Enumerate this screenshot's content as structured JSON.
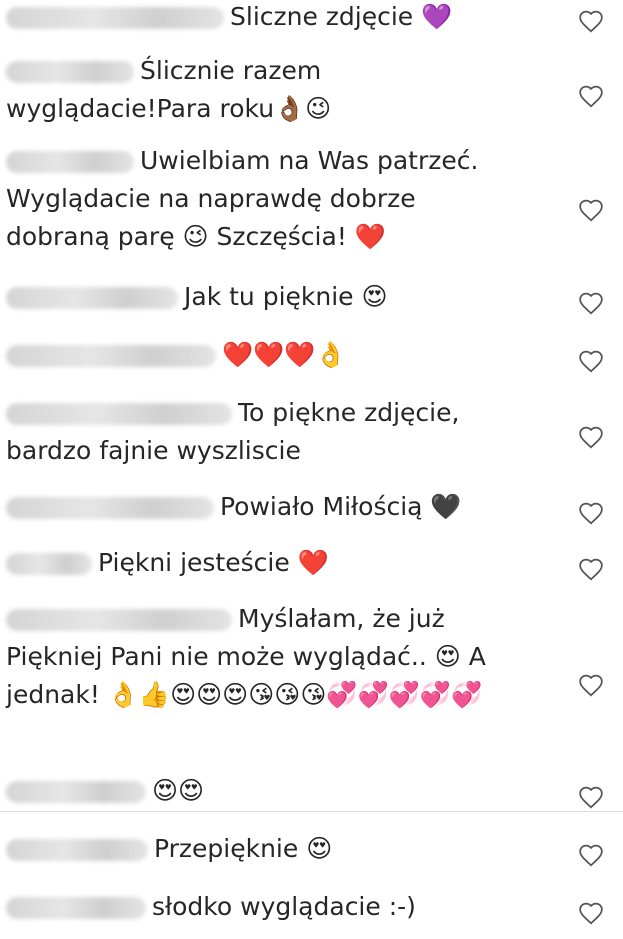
{
  "comments": [
    {
      "text": "Sliczne zdjęcie 💜"
    },
    {
      "text": "Ślicznie razem wyglądacie!Para roku👌🏾😉"
    },
    {
      "text": "Uwielbiam na Was patrzeć. Wyglądacie na naprawdę dobrze dobraną parę 😉 Szczęścia! ❤️"
    },
    {
      "text": "Jak tu pięknie 😍"
    },
    {
      "text": "❤️❤️❤️👌"
    },
    {
      "text": "To piękne zdjęcie, bardzo fajnie wyszliscie"
    },
    {
      "text": "Powiało Miłością 🖤"
    },
    {
      "text": "Piękni jesteście ❤️"
    },
    {
      "text": "Myślałam, że już Piękniej Pani nie może wyglądać.. 😍 A jednak! 👌👍😍😍😍😘😘😘💞💞💞💞💞"
    },
    {
      "text": "😍😍"
    },
    {
      "text": "Przepięknie 😍"
    },
    {
      "text": "słodko wyglądacie :-)"
    }
  ],
  "icons": {
    "like": "heart-outline-icon"
  }
}
